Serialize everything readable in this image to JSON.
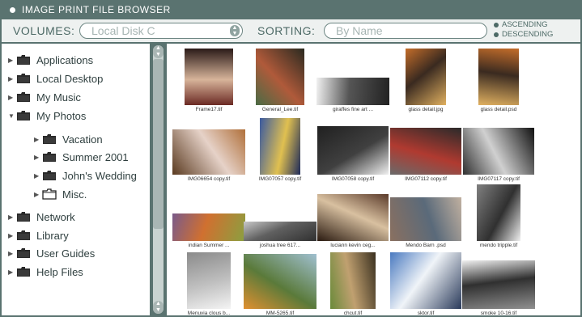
{
  "window": {
    "title": "IMAGE PRINT FILE BROWSER"
  },
  "toolbar": {
    "volumes_label": "VOLUMES:",
    "volumes_value": "Local Disk C",
    "sorting_label": "SORTING:",
    "sorting_value": "By Name",
    "order_options": [
      "ASCENDING",
      "DESCENDING"
    ]
  },
  "tree": [
    {
      "label": "Applications",
      "expanded": false,
      "open_folder": false
    },
    {
      "label": "Local Desktop",
      "expanded": false,
      "open_folder": false
    },
    {
      "label": "My Music",
      "expanded": false,
      "open_folder": false
    },
    {
      "label": "My Photos",
      "expanded": true,
      "open_folder": false
    },
    {
      "label": "Vacation",
      "expanded": false,
      "open_folder": false
    },
    {
      "label": "Summer 2001",
      "expanded": false,
      "open_folder": false
    },
    {
      "label": "John's Wedding",
      "expanded": false,
      "open_folder": false
    },
    {
      "label": "Misc.",
      "expanded": false,
      "open_folder": true
    },
    {
      "label": "Network",
      "expanded": false,
      "open_folder": false
    },
    {
      "label": "Library",
      "expanded": false,
      "open_folder": false
    },
    {
      "label": "User Guides",
      "expanded": false,
      "open_folder": false
    },
    {
      "label": "Help Files",
      "expanded": false,
      "open_folder": false
    }
  ],
  "thumbnails": [
    {
      "caption": "Frame17.tif",
      "palette": [
        "#6b2a24",
        "#d7b49a",
        "#2a1a18"
      ]
    },
    {
      "caption": "General_Lee.tif",
      "palette": [
        "#4a6b45",
        "#b05a3a",
        "#2a2a20"
      ]
    },
    {
      "caption": "giraffes fine art ...",
      "palette": [
        "#f2f2f2",
        "#555555",
        "#222222"
      ]
    },
    {
      "caption": "glass detail.jpg",
      "palette": [
        "#c46d2a",
        "#3a2a20",
        "#e0b060"
      ]
    },
    {
      "caption": "glass detail.psd",
      "palette": [
        "#c46d2a",
        "#3a2a20",
        "#e0b060"
      ]
    },
    {
      "caption": "IMG06654 copy.tif",
      "palette": [
        "#b0703a",
        "#e6d2c8",
        "#5a3a20"
      ]
    },
    {
      "caption": "IMG07057 copy.tif",
      "palette": [
        "#1e2a5a",
        "#e0c050",
        "#3a5aa0"
      ]
    },
    {
      "caption": "IMG07058 copy.tif",
      "palette": [
        "#f0f0f0",
        "#404040",
        "#202020"
      ]
    },
    {
      "caption": "IMG07112 copy.tif",
      "palette": [
        "#6a6a6a",
        "#b03a30",
        "#2a2a2a"
      ]
    },
    {
      "caption": "IMG07117 copy.tif",
      "palette": [
        "#303030",
        "#d0d0d0",
        "#101010"
      ]
    },
    {
      "caption": "indian Summer ...",
      "palette": [
        "#7a5a8a",
        "#d07030",
        "#8aa040"
      ]
    },
    {
      "caption": "joshua tree 617...",
      "palette": [
        "#c8c8c8",
        "#606060",
        "#303030"
      ]
    },
    {
      "caption": "luciann kevin ceg...",
      "palette": [
        "#5a3a2a",
        "#d8c0a0",
        "#2a1a10"
      ]
    },
    {
      "caption": "Mendo Barn .psd",
      "palette": [
        "#c0b0a0",
        "#5a6a7a",
        "#8a7060"
      ]
    },
    {
      "caption": "mendo tripple.tif",
      "palette": [
        "#f0f0f0",
        "#303030",
        "#808080"
      ]
    },
    {
      "caption": "Menuvia clous b...",
      "palette": [
        "#f4f4f4",
        "#c0c0c0",
        "#8a8a8a"
      ]
    },
    {
      "caption": "MM-5265.tif",
      "palette": [
        "#e09030",
        "#5a7a3a",
        "#a0c0d0"
      ]
    },
    {
      "caption": "chcut.tif",
      "palette": [
        "#6a8a3a",
        "#c0a070",
        "#3a3020"
      ]
    },
    {
      "caption": "sktor.tif",
      "palette": [
        "#4a7ac0",
        "#f0f4f8",
        "#2a3a5a"
      ]
    },
    {
      "caption": "smoke 10-16.tif",
      "palette": [
        "#f0f0f0",
        "#303030",
        "#909090"
      ]
    }
  ],
  "colors": {
    "chrome": "#5a7370",
    "toolbar_bg": "#eef1f0",
    "label": "#4d6a66"
  },
  "icons": {
    "folder": "folder-icon",
    "folder_open": "folder-open-icon",
    "scroll_up": "arrow-up-icon",
    "scroll_down": "arrow-down-icon"
  }
}
